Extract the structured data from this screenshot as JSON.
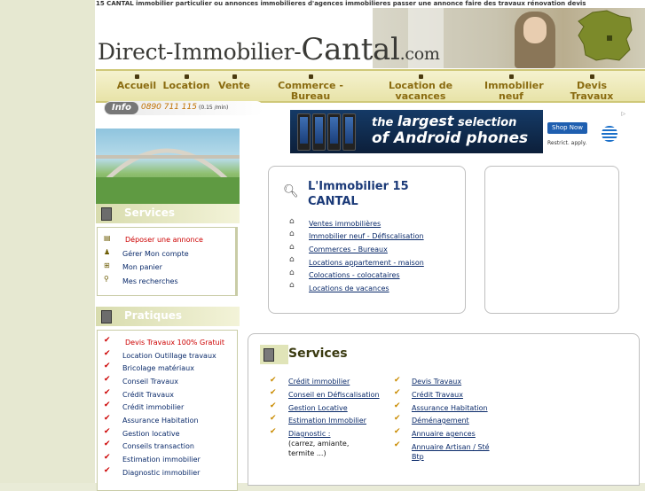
{
  "header": {
    "top_text": "15 CANTAL immobilier particulier ou annonces immobilieres d'agences immobilieres passer une annonce faire des travaux rénovation devis",
    "logo_part1": "Direct-Immobilier-",
    "logo_part2": "Cantal",
    "logo_part3": ".com"
  },
  "nav": {
    "items": [
      {
        "label": "Accueil"
      },
      {
        "label": "Location"
      },
      {
        "label": "Vente"
      },
      {
        "label": "Commerce - Bureau"
      },
      {
        "label": "Location de vacances"
      },
      {
        "label": "Immobilier neuf"
      },
      {
        "label": "Devis Travaux"
      }
    ]
  },
  "info": {
    "badge": "Info",
    "phone": "0890 711 115",
    "price": "(0.15 /min)"
  },
  "banner": {
    "line1_a": "the",
    "line1_b": "largest",
    "line1_c": "selection",
    "line2_a": "of",
    "line2_b": "Android",
    "line2_c": "phones",
    "shop_button": "Shop Now",
    "restrict": "Restrict. apply."
  },
  "sidebar": {
    "services_title": "Services",
    "services_items": [
      {
        "label": "Déposer une annonce"
      },
      {
        "label": "Gérer Mon compte"
      },
      {
        "label": "Mon panier"
      },
      {
        "label": "Mes recherches"
      }
    ],
    "pratiques_title": "Pratiques",
    "pratiques_items": [
      {
        "label": "Devis Travaux 100% Gratuit"
      },
      {
        "label": "Location Outillage travaux"
      },
      {
        "label": "Bricolage matériaux"
      },
      {
        "label": "Conseil Travaux"
      },
      {
        "label": "Crédit Travaux"
      },
      {
        "label": "Crédit immobilier"
      },
      {
        "label": "Assurance Habitation"
      },
      {
        "label": "Gestion locative"
      },
      {
        "label": "Conseils transaction"
      },
      {
        "label": "Estimation immobilier"
      },
      {
        "label": "Diagnostic immobilier"
      }
    ]
  },
  "main": {
    "box_title": "L'Immobilier 15 CANTAL",
    "links": [
      {
        "label": "Ventes immobilières"
      },
      {
        "label": "Immobilier neuf - Défiscalisation"
      },
      {
        "label": "Commerces - Bureaux"
      },
      {
        "label": "Locations appartement - maison"
      },
      {
        "label": "Colocations - colocataires"
      },
      {
        "label": "Locations de vacances"
      }
    ],
    "services_title": "Services",
    "col1": [
      {
        "label": "Crédit immobilier"
      },
      {
        "label": "Conseil en Défiscalisation"
      },
      {
        "label": "Gestion Locative"
      },
      {
        "label": "Estimation Immobilier"
      },
      {
        "label": "Diagnostic :"
      }
    ],
    "col1_note1": "(carrez, amiante,",
    "col1_note2": "termite ...)",
    "col2": [
      {
        "label": "Devis Travaux"
      },
      {
        "label": "Crédit Travaux"
      },
      {
        "label": "Assurance Habitation"
      },
      {
        "label": "Déménagement"
      },
      {
        "label": "Annuaire agences"
      },
      {
        "label": "Annuaire Artisan / Sté"
      }
    ],
    "col2_note": "Btp"
  }
}
